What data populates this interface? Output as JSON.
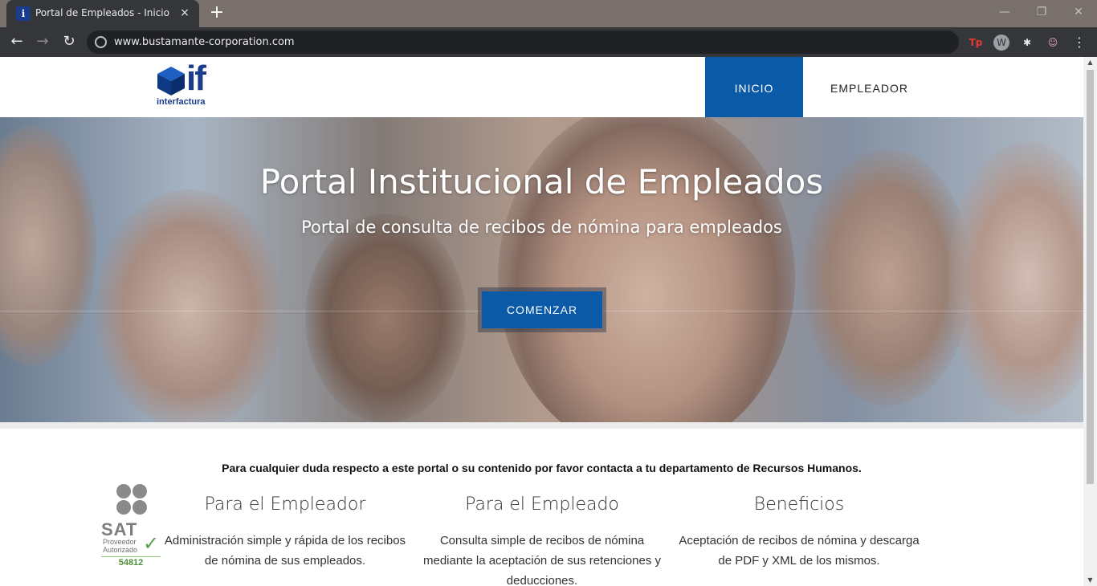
{
  "browser": {
    "tab_title": "Portal de Empleados - Inicio",
    "tab_close": "×",
    "new_tab": "+",
    "url": "www.bustamante-corporation.com",
    "back": "←",
    "forward": "→",
    "reload": "↻",
    "ext_tp": "Tp",
    "ext_w": "W",
    "ext_puzzle": "✱",
    "ext_profile": "☺",
    "menu": "⋮",
    "minimize": "—",
    "restore": "❐",
    "close": "✕"
  },
  "header": {
    "logo_mark": "if",
    "logo_text": "interfactura",
    "nav": [
      {
        "label": "INICIO"
      },
      {
        "label": "EMPLEADOR"
      }
    ]
  },
  "hero": {
    "title": "Portal Institucional de Empleados",
    "subtitle": "Portal de consulta de recibos de nómina para empleados",
    "cta": "COMENZAR"
  },
  "notice": "Para cualquier duda respecto a este portal o su contenido por favor contacta a tu departamento de Recursos Humanos.",
  "sat": {
    "label": "SAT",
    "line1": "Proveedor",
    "line2": "Autorizado",
    "number": "54812"
  },
  "features": [
    {
      "title": "Para el Empleador",
      "text": "Administración simple y rápida de los recibos de nómina de sus empleados."
    },
    {
      "title": "Para el Empleado",
      "text": "Consulta simple de recibos de nómina mediante la aceptación de sus retenciones y deducciones."
    },
    {
      "title": "Beneficios",
      "text": "Aceptación de recibos de nómina y descarga de PDF y XML de los mismos."
    }
  ],
  "colors": {
    "brand": "#0b5aa8",
    "chrome_dark": "#35363a"
  }
}
